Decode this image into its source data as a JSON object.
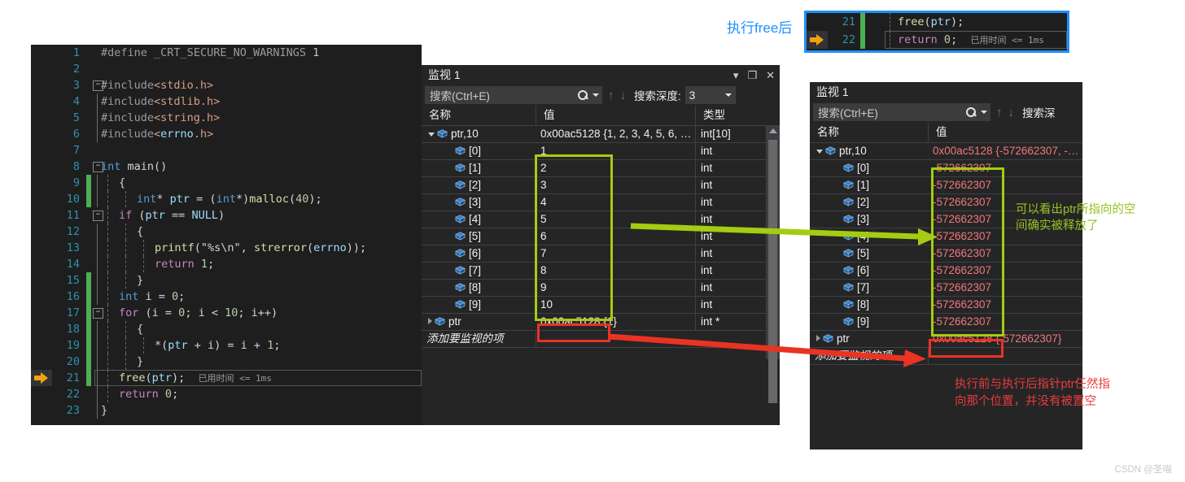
{
  "editor": {
    "lines": [
      {
        "n": "1",
        "text": "#define _CRT_SECURE_NO_WARNINGS 1"
      },
      {
        "n": "2",
        "text": ""
      },
      {
        "n": "3",
        "text": "#include<stdio.h>"
      },
      {
        "n": "4",
        "text": "#include<stdlib.h>"
      },
      {
        "n": "5",
        "text": "#include<string.h>"
      },
      {
        "n": "6",
        "text": "#include<errno.h>"
      },
      {
        "n": "7",
        "text": ""
      },
      {
        "n": "8",
        "text": "int main()"
      },
      {
        "n": "9",
        "text": "{"
      },
      {
        "n": "10",
        "text": "int* ptr = (int*)malloc(40);"
      },
      {
        "n": "11",
        "text": "if (ptr == NULL)"
      },
      {
        "n": "12",
        "text": "{"
      },
      {
        "n": "13",
        "text": "printf(\"%s\\n\", strerror(errno));"
      },
      {
        "n": "14",
        "text": "return 1;"
      },
      {
        "n": "15",
        "text": "}"
      },
      {
        "n": "16",
        "text": "int i = 0;"
      },
      {
        "n": "17",
        "text": "for (i = 0; i < 10; i++)"
      },
      {
        "n": "18",
        "text": "{"
      },
      {
        "n": "19",
        "text": "*(ptr + i) = i + 1;"
      },
      {
        "n": "20",
        "text": "}"
      },
      {
        "n": "21",
        "text": "free(ptr);"
      },
      {
        "n": "22",
        "text": "return 0;"
      },
      {
        "n": "23",
        "text": "}"
      }
    ],
    "elapsed_tip": "已用时间 <= 1ms"
  },
  "snippet": {
    "label": "执行free后",
    "lines": [
      {
        "n": "21",
        "text": "free(ptr);"
      },
      {
        "n": "22",
        "text": "return 0;"
      }
    ],
    "elapsed_tip": "已用时间 <= 1ms",
    "border_color": "#1e90ff"
  },
  "watch_before": {
    "title": "监视 1",
    "buttons": {
      "dropdown": "▾",
      "maximize": "❐",
      "close": "✕"
    },
    "search_placeholder": "搜索(Ctrl+E)",
    "depth_label": "搜索深度:",
    "depth_value": "3",
    "columns": [
      "名称",
      "值",
      "类型"
    ],
    "rows": [
      {
        "name": "ptr,10",
        "value": "0x00ac5128 {1, 2, 3, 4, 5, 6, …",
        "type": "int[10]",
        "expander": "down",
        "indent": 0
      },
      {
        "name": "[0]",
        "value": "1",
        "type": "int",
        "expander": "none",
        "indent": 1
      },
      {
        "name": "[1]",
        "value": "2",
        "type": "int",
        "expander": "none",
        "indent": 1
      },
      {
        "name": "[2]",
        "value": "3",
        "type": "int",
        "expander": "none",
        "indent": 1
      },
      {
        "name": "[3]",
        "value": "4",
        "type": "int",
        "expander": "none",
        "indent": 1
      },
      {
        "name": "[4]",
        "value": "5",
        "type": "int",
        "expander": "none",
        "indent": 1
      },
      {
        "name": "[5]",
        "value": "6",
        "type": "int",
        "expander": "none",
        "indent": 1
      },
      {
        "name": "[6]",
        "value": "7",
        "type": "int",
        "expander": "none",
        "indent": 1
      },
      {
        "name": "[7]",
        "value": "8",
        "type": "int",
        "expander": "none",
        "indent": 1
      },
      {
        "name": "[8]",
        "value": "9",
        "type": "int",
        "expander": "none",
        "indent": 1
      },
      {
        "name": "[9]",
        "value": "10",
        "type": "int",
        "expander": "none",
        "indent": 1
      },
      {
        "name": "ptr",
        "value": "0x00ac5128 {1}",
        "type": "int *",
        "expander": "right",
        "indent": 0
      }
    ],
    "add_row": "添加要监视的项"
  },
  "watch_after": {
    "title": "监视 1",
    "search_placeholder": "搜索(Ctrl+E)",
    "depth_label": "搜索深",
    "columns": [
      "名称",
      "值"
    ],
    "rows": [
      {
        "name": "ptr,10",
        "value": "0x00ac5128 {-572662307, -…",
        "expander": "down",
        "indent": 0
      },
      {
        "name": "[0]",
        "value": "-572662307",
        "expander": "none",
        "indent": 1
      },
      {
        "name": "[1]",
        "value": "-572662307",
        "expander": "none",
        "indent": 1
      },
      {
        "name": "[2]",
        "value": "-572662307",
        "expander": "none",
        "indent": 1
      },
      {
        "name": "[3]",
        "value": "-572662307",
        "expander": "none",
        "indent": 1
      },
      {
        "name": "[4]",
        "value": "-572662307",
        "expander": "none",
        "indent": 1
      },
      {
        "name": "[5]",
        "value": "-572662307",
        "expander": "none",
        "indent": 1
      },
      {
        "name": "[6]",
        "value": "-572662307",
        "expander": "none",
        "indent": 1
      },
      {
        "name": "[7]",
        "value": "-572662307",
        "expander": "none",
        "indent": 1
      },
      {
        "name": "[8]",
        "value": "-572662307",
        "expander": "none",
        "indent": 1
      },
      {
        "name": "[9]",
        "value": "-572662307",
        "expander": "none",
        "indent": 1
      },
      {
        "name": "ptr",
        "value": "0x00ac5128 {-572662307}",
        "expander": "right",
        "indent": 0
      }
    ],
    "add_row": "添加要监视的项"
  },
  "annotations": {
    "green_note_line1": "可以看出ptr所指向的空",
    "green_note_line2": "间确实被释放了",
    "red_note_line1": "执行前与执行后指针ptr任然指",
    "red_note_line2": "向那个位置，并没有被置空",
    "green_color": "#a4cc11",
    "red_color": "#e83c3c"
  },
  "watermark": "CSDN @圣喵"
}
